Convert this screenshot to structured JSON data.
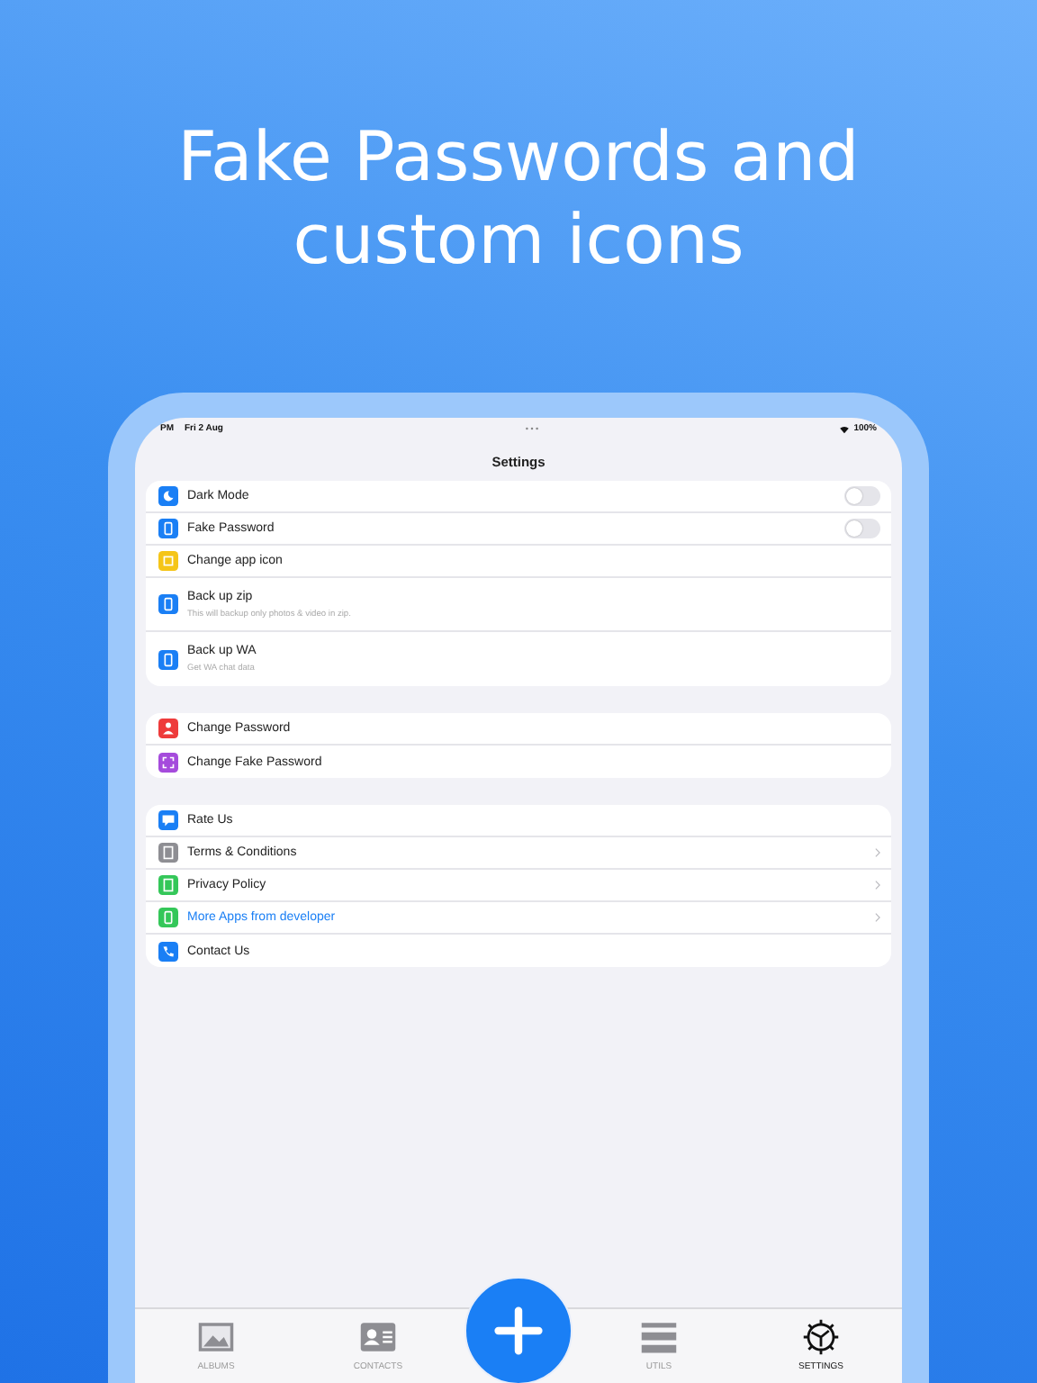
{
  "headline": "Fake Passwords and custom icons",
  "status_bar": {
    "time": "PM",
    "date": "Fri 2 Aug",
    "battery": "100%"
  },
  "title": "Settings",
  "groups": [
    {
      "rows": [
        {
          "label": "Dark Mode",
          "kind": "toggle",
          "on": false,
          "color": "#1a7ff5"
        },
        {
          "label": "Fake Password",
          "kind": "toggle",
          "on": false,
          "color": "#1a7ff5"
        },
        {
          "label": "Change app icon",
          "kind": "plain",
          "color": "#f5c518"
        },
        {
          "label": "Back up zip",
          "kind": "subtitle",
          "subtitle": "This will backup only photos & video in zip.",
          "color": "#1a7ff5"
        },
        {
          "label": "Back up WA",
          "kind": "subtitle",
          "subtitle": "Get WA chat data",
          "color": "#1a7ff5"
        }
      ]
    },
    {
      "rows": [
        {
          "label": "Change Password",
          "kind": "plain",
          "color": "#ee3b3b"
        },
        {
          "label": "Change Fake Password",
          "kind": "plain",
          "color": "#a54bdc"
        }
      ]
    },
    {
      "rows": [
        {
          "label": "Rate Us",
          "kind": "plain",
          "color": "#1a7ff5"
        },
        {
          "label": "Terms & Conditions",
          "kind": "chevron",
          "color": "#8e8e93"
        },
        {
          "label": "Privacy Policy",
          "kind": "chevron",
          "color": "#34c759"
        },
        {
          "label": "More Apps from developer",
          "kind": "chevron",
          "accent": true,
          "color": "#34c759"
        },
        {
          "label": "Contact Us",
          "kind": "plain",
          "color": "#1a7ff5"
        }
      ]
    }
  ],
  "tabs": [
    {
      "label": "ALBUMS",
      "selected": false
    },
    {
      "label": "CONTACTS",
      "selected": false
    },
    {
      "label": "UTILS",
      "selected": false
    },
    {
      "label": "SETTINGS",
      "selected": true
    }
  ]
}
